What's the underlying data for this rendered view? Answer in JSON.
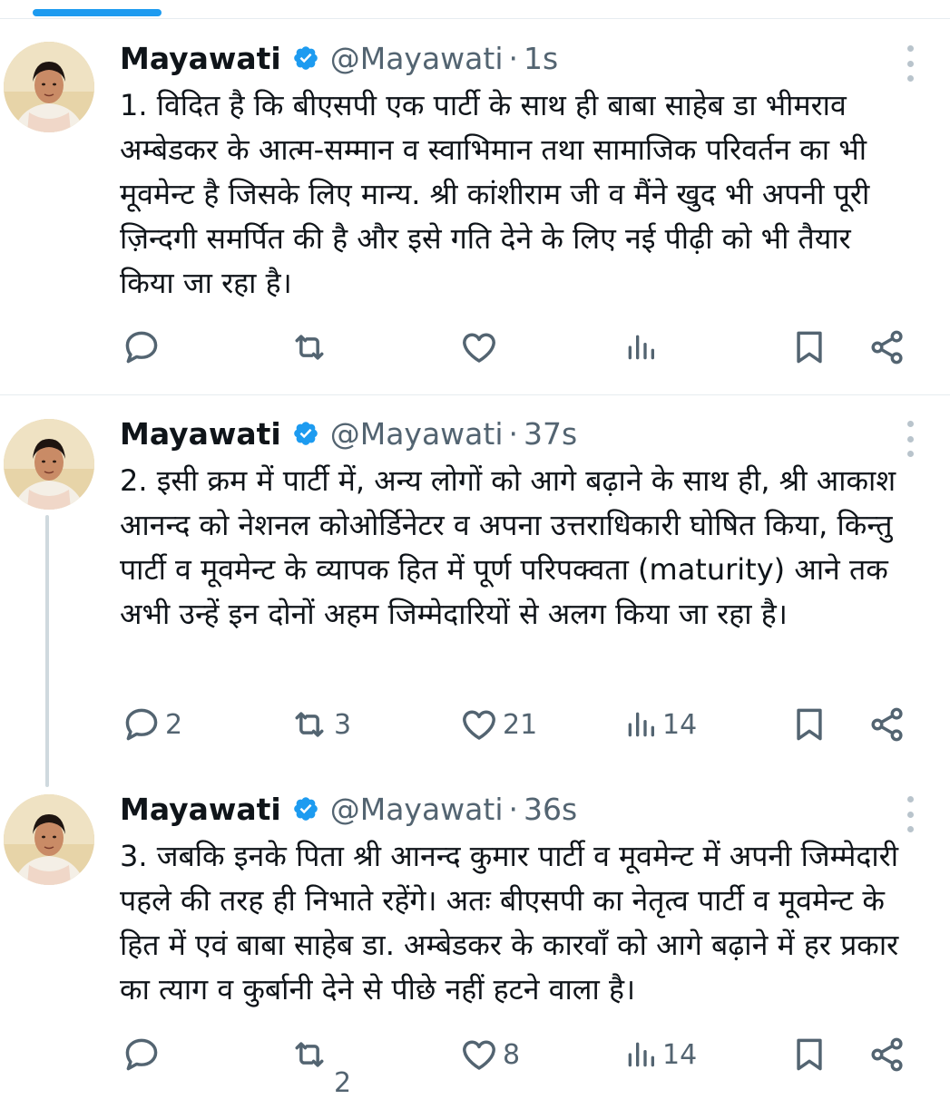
{
  "author": {
    "name": "Mayawati",
    "handle": "@Mayawati"
  },
  "tweets": [
    {
      "time": "1s",
      "text": "1. विदित है कि बीएसपी एक पार्टी के साथ ही बाबा साहेब डा भीमराव अम्बेडकर के आत्म-सम्मान व स्वाभिमान तथा सामाजिक परिवर्तन का भी मूवमेन्ट है जिसके लिए मान्य. श्री कांशीराम जी व मैंने खुद भी अपनी पूरी ज़िन्दगी समर्पित की है और इसे गति देने के लिए नई पीढ़ी को भी तैयार किया जा रहा है।",
      "replies": "",
      "reposts": "",
      "likes": "",
      "views": ""
    },
    {
      "time": "37s",
      "text": "2. इसी क्रम में पार्टी में, अन्य लोगों को आगे बढ़ाने के साथ ही, श्री आकाश आनन्द को नेशनल कोओर्डिनेटर व अपना उत्तराधिकारी घोषित किया, किन्तु पार्टी व मूवमेन्ट के व्यापक हित में पूर्ण परिपक्वता (maturity) आने तक अभी उन्हें इन दोनों अहम जिम्मेदारियों से अलग किया जा रहा है।",
      "replies": "2",
      "reposts": "3",
      "likes": "21",
      "views": "14"
    },
    {
      "time": "36s",
      "text": "3. जबकि इनके पिता श्री आनन्द कुमार पार्टी व मूवमेन्ट में अपनी जिम्मेदारी पहले की तरह ही निभाते रहेंगे। अतः बीएसपी का नेतृत्व पार्टी व मूवमेन्ट के हित में एवं बाबा साहेब डा. अम्बेडकर के कारवाँ को आगे बढ़ाने में हर प्रकार का त्याग व कुर्बानी देने से पीछे नहीं हटने वाला है।",
      "replies": "",
      "reposts": "",
      "likes": "8",
      "views": "14",
      "cut_off_digit": "2"
    }
  ],
  "icons": {
    "reply": "reply-icon",
    "repost": "repost-icon",
    "like": "heart-icon",
    "views": "views-icon",
    "bookmark": "bookmark-icon",
    "share": "share-icon",
    "more": "more-icon",
    "verified": "verified-badge-icon"
  },
  "colors": {
    "accent": "#1d9bf0",
    "muted": "#536471",
    "text": "#0f1419"
  }
}
